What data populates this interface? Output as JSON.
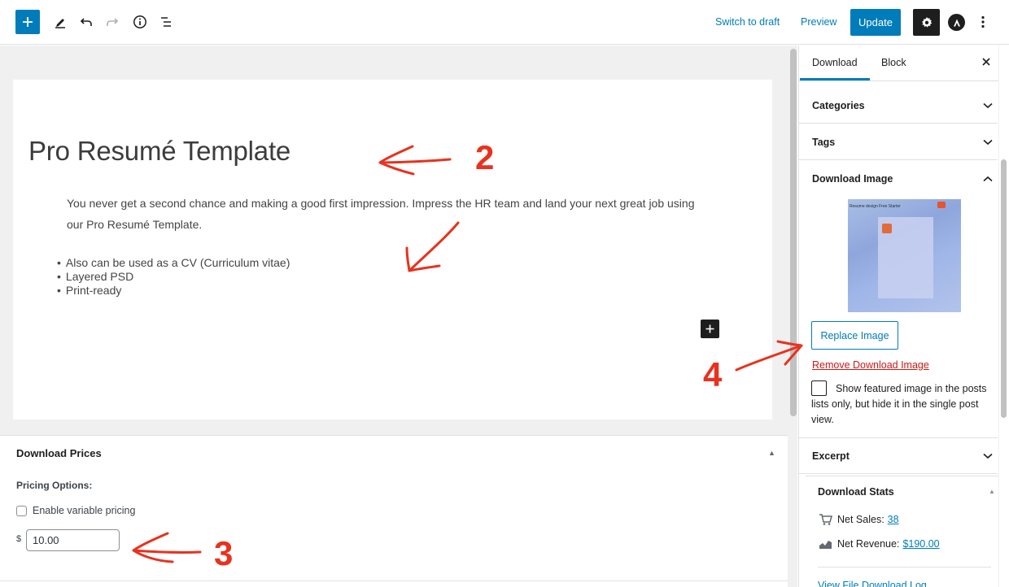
{
  "toolbar": {
    "switch_to_draft": "Switch to draft",
    "preview": "Preview",
    "update": "Update"
  },
  "post": {
    "title": "Pro Resumé Template",
    "paragraph": "You never get a second chance and making a good first impression. Impress the HR team and land your next great job using our Pro Resumé Template.",
    "list": [
      "Also can be used as a CV (Curriculum vitae)",
      "Layered PSD",
      "Print-ready"
    ]
  },
  "download_prices": {
    "title": "Download Prices",
    "pricing_options": "Pricing Options:",
    "variable_pricing_label": "Enable variable pricing",
    "variable_pricing_checked": false,
    "currency": "$",
    "price": "10.00"
  },
  "sidebar": {
    "tabs": [
      {
        "label": "Download",
        "active": true
      },
      {
        "label": "Block",
        "active": false
      }
    ],
    "panels": {
      "categories": "Categories",
      "tags": "Tags",
      "download_image": "Download Image",
      "excerpt": "Excerpt"
    },
    "download_image": {
      "thumbnail_caption": "Resume design Free Starter",
      "replace_label": "Replace Image",
      "remove_label": "Remove Download Image",
      "featured_text": "Show featured image in the posts lists only, but hide it in the single post view.",
      "featured_checked": false
    },
    "download_stats": {
      "title": "Download Stats",
      "net_sales_label": "Net Sales:",
      "net_sales_value": "38",
      "net_revenue_label": "Net Revenue:",
      "net_revenue_value": "$190.00",
      "file_log_link": "View File Download Log"
    }
  },
  "annotations": [
    "2",
    "3",
    "4"
  ],
  "colors": {
    "accent": "#007cba",
    "destructive": "#cc1818",
    "annotation": "#e8321e",
    "editor_bg": "#f0f0f0",
    "dark": "#1e1e1e"
  },
  "icons": {
    "add": "plus-icon",
    "tools": "pencil-icon",
    "undo": "undo-icon",
    "redo": "redo-icon",
    "details": "info-icon",
    "outline": "list-view-icon",
    "settings": "gear-icon",
    "plugin": "astra-icon",
    "options": "kebab-icon",
    "close": "close-icon",
    "cart": "cart-icon",
    "revenue": "chart-icon"
  }
}
